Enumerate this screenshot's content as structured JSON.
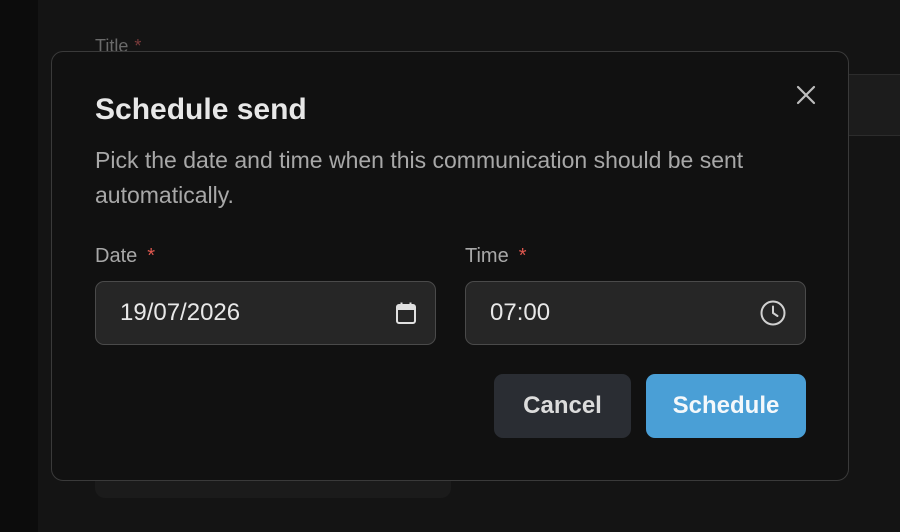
{
  "background": {
    "title_label": "Title",
    "required_mark": "*"
  },
  "dialog": {
    "title": "Schedule send",
    "description": "Pick the date and time when this communication should be sent automatically.",
    "close_icon": "close-icon",
    "date": {
      "label": "Date",
      "required_mark": "*",
      "value": "19/07/2026",
      "icon": "calendar-icon"
    },
    "time": {
      "label": "Time",
      "required_mark": "*",
      "value": "07:00",
      "icon": "clock-icon"
    },
    "buttons": {
      "cancel": "Cancel",
      "schedule": "Schedule"
    }
  },
  "colors": {
    "accent": "#4a9fd6",
    "required": "#e0584f",
    "modal_bg": "#111111"
  }
}
